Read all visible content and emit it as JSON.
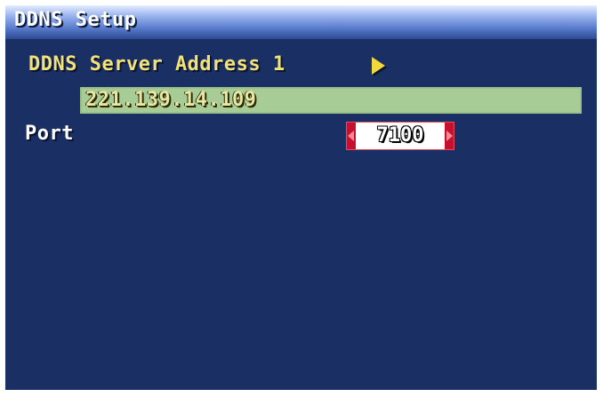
{
  "window": {
    "title": "DDNS Setup"
  },
  "ddns": {
    "server_label": "DDNS Server Address 1",
    "server_address": "221.139.14.109"
  },
  "port": {
    "label": "Port",
    "value": "7100"
  },
  "colors": {
    "background": "#1a2f63",
    "label_yellow": "#f1e27a",
    "field_green": "#a8cc96",
    "spinner_red": "#c8102e"
  }
}
